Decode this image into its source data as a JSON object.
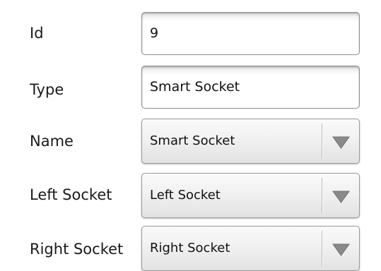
{
  "form": {
    "id": {
      "label": "Id",
      "value": "9"
    },
    "type": {
      "label": "Type",
      "value": "Smart Socket"
    },
    "name": {
      "label": "Name",
      "selected": "Smart Socket"
    },
    "left_socket": {
      "label": "Left Socket",
      "selected": "Left Socket"
    },
    "right_socket": {
      "label": "Right Socket",
      "selected": "Right Socket"
    }
  },
  "icons": {
    "dropdown": "chevron-down-icon"
  },
  "colors": {
    "arrow": "#8a8a8a",
    "border": "#9a9a9a",
    "background": "#ffffff"
  }
}
